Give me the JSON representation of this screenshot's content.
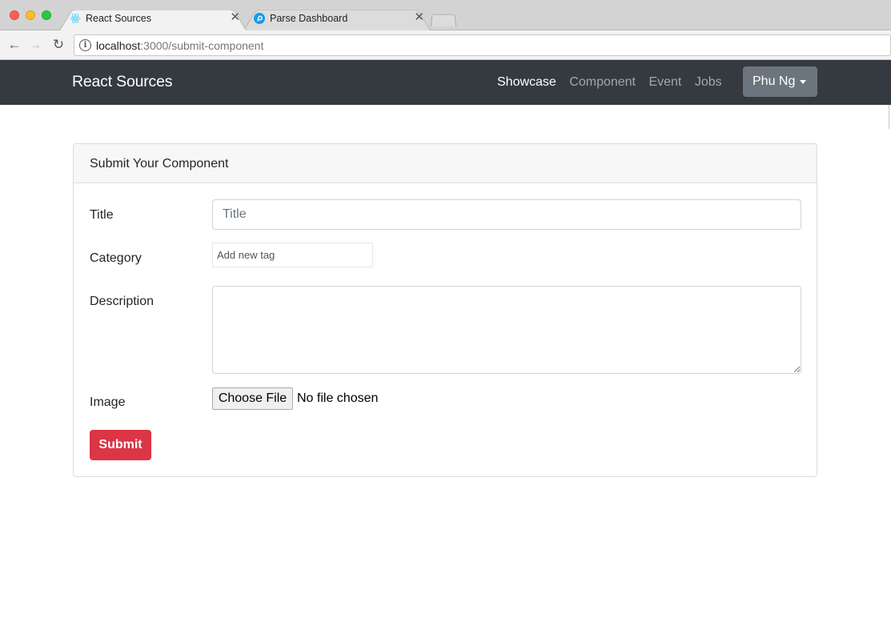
{
  "browser": {
    "tabs": [
      {
        "title": "React Sources",
        "icon": "react-icon",
        "active": true
      },
      {
        "title": "Parse Dashboard",
        "icon": "parse-icon",
        "active": false
      }
    ],
    "url_host": "localhost",
    "url_path": ":3000/submit-component"
  },
  "navbar": {
    "brand": "React Sources",
    "links": [
      "Showcase",
      "Component",
      "Event",
      "Jobs"
    ],
    "active_link": "Showcase",
    "user_menu": "Phu Ng"
  },
  "card": {
    "header": "Submit Your Component",
    "title_label": "Title",
    "title_placeholder": "Title",
    "category_label": "Category",
    "category_placeholder": "Add new tag",
    "description_label": "Description",
    "image_label": "Image",
    "file_button": "Choose File",
    "file_status": "No file chosen",
    "submit_label": "Submit"
  },
  "colors": {
    "navbar_bg": "#343a40",
    "user_button": "#6c757d",
    "submit_button": "#dc3545"
  }
}
